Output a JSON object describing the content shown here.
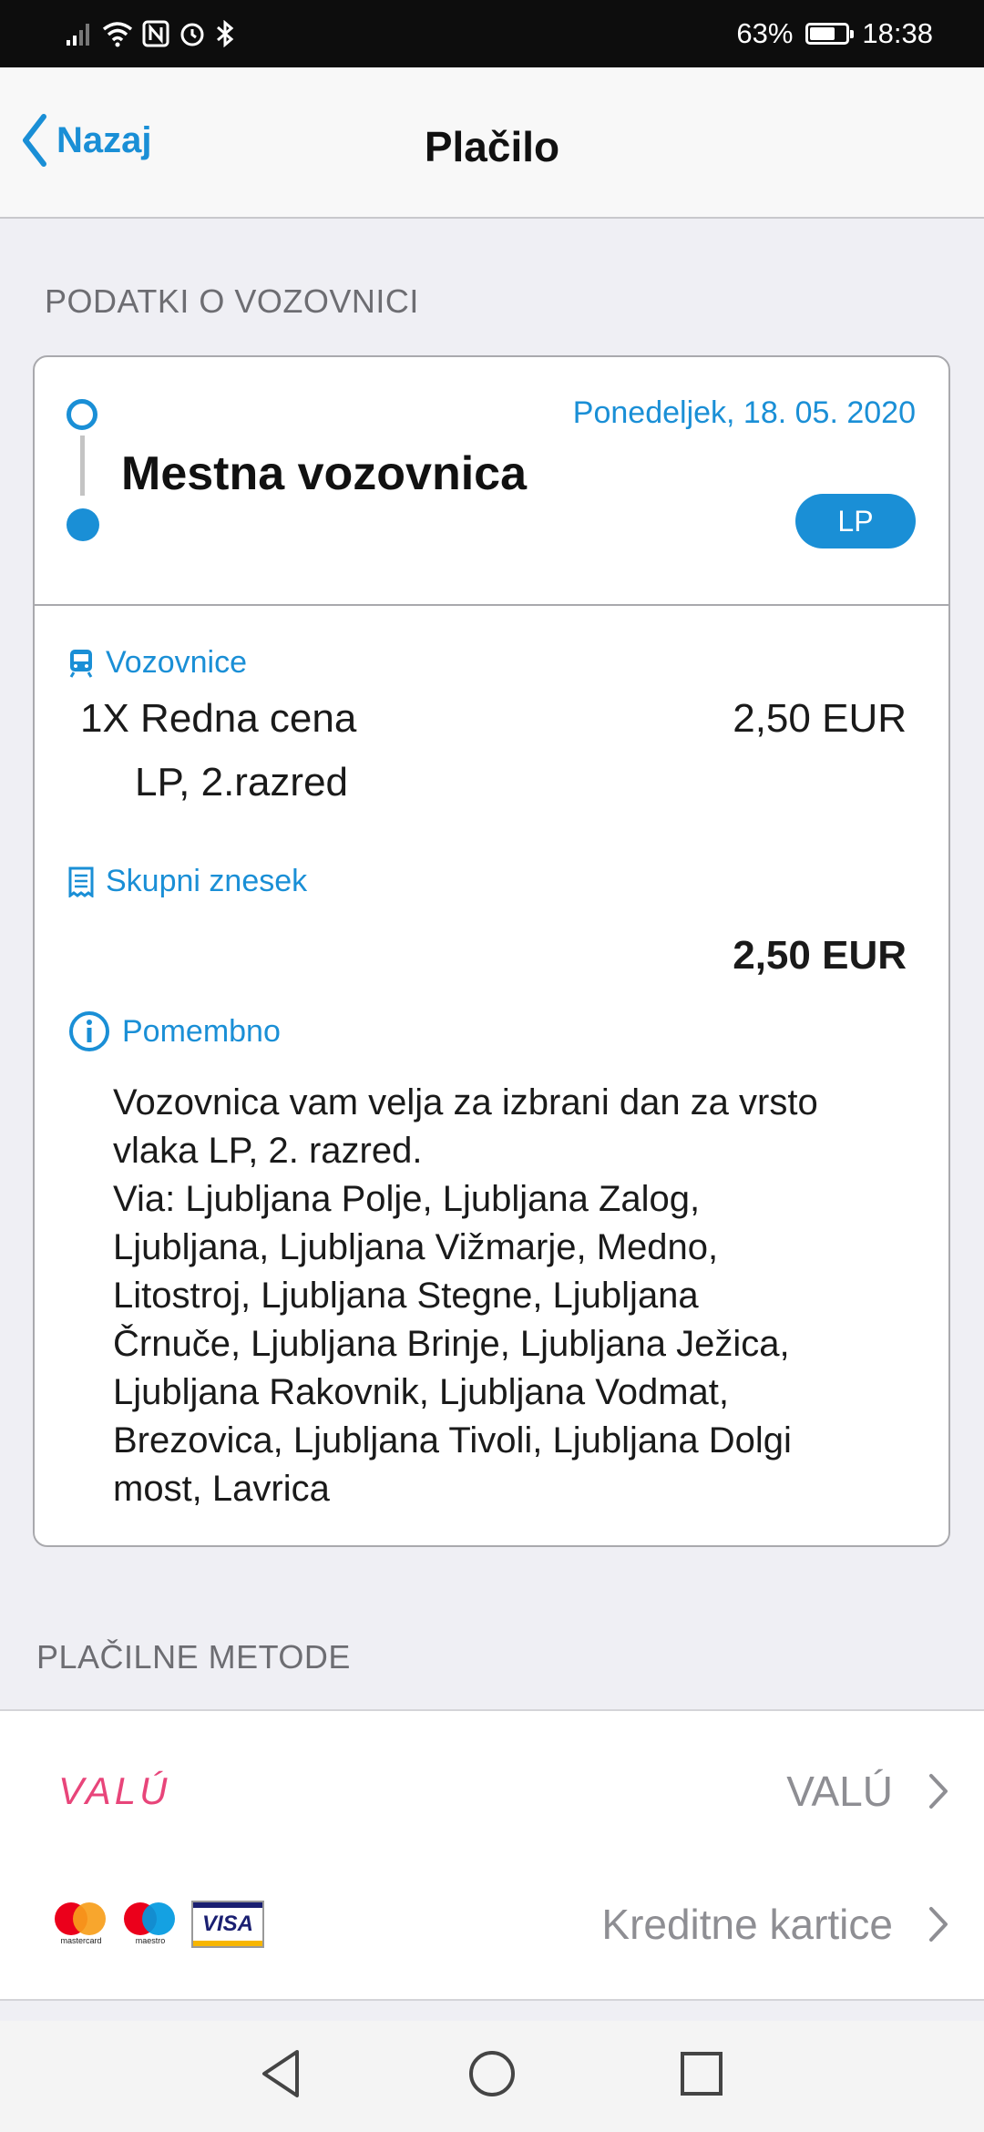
{
  "status": {
    "battery": "63%",
    "time": "18:38",
    "battery_level": 0.63
  },
  "nav": {
    "back_label": "Nazaj",
    "title": "Plačilo"
  },
  "ticket_section_label": "PODATKI O VOZOVNICI",
  "ticket": {
    "date": "Ponedeljek, 18. 05. 2020",
    "name": "Mestna vozovnica",
    "badge": "LP",
    "tickets_label": "Vozovnice",
    "line1": "1X Redna cena",
    "line2": "LP, 2.razred",
    "price": "2,50 EUR",
    "total_label": "Skupni znesek",
    "total": "2,50 EUR",
    "important_label": "Pomembno",
    "important_text": "Vozovnica vam velja za izbrani dan za vrsto\nvlaka LP, 2. razred.\nVia: Ljubljana Polje, Ljubljana Zalog,\nLjubljana, Ljubljana Vižmarje, Medno,\nLitostroj, Ljubljana Stegne, Ljubljana\nČrnuče, Ljubljana Brinje, Ljubljana Ježica,\nLjubljana Rakovnik, Ljubljana Vodmat,\nBrezovica, Ljubljana Tivoli, Ljubljana Dolgi\nmost, Lavrica"
  },
  "payment_section_label": "PLAČILNE METODE",
  "payment_methods": [
    {
      "logo_text": "VALÚ",
      "label": "VALÚ"
    },
    {
      "logo_text": "VISA",
      "mastercard_caption": "mastercard",
      "maestro_caption": "maestro",
      "label": "Kreditne kartice"
    }
  ],
  "colors": {
    "accent": "#1a8fd6",
    "valu": "#e8457a",
    "mastercard_red": "#eb001b",
    "mastercard_orange": "#f79e1b",
    "maestro_blue": "#0099df",
    "visa_blue": "#1a1f71",
    "visa_gold": "#f7b600"
  },
  "icons": [
    "signal-icon",
    "wifi-icon",
    "nfc-icon",
    "alarm-icon",
    "bluetooth-icon",
    "battery-icon",
    "train-icon",
    "receipt-icon",
    "info-icon",
    "chevron-right-icon",
    "back-triangle-icon",
    "home-circle-icon",
    "recents-square-icon"
  ]
}
